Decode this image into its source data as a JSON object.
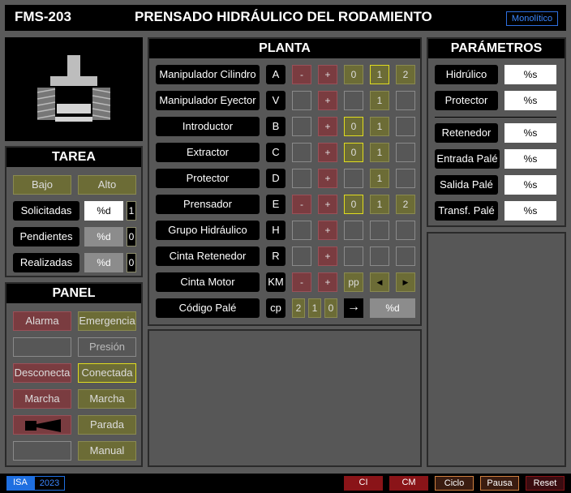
{
  "header": {
    "code": "FMS-203",
    "title": "PRENSADO HIDRÁULICO DEL RODAMIENTO",
    "mode": "Monolítico"
  },
  "tarea": {
    "title": "TAREA",
    "bajo": "Bajo",
    "alto": "Alto",
    "rows": [
      {
        "label": "Solicitadas",
        "value": "%d",
        "count": "1"
      },
      {
        "label": "Pendientes",
        "value": "%d",
        "count": "0"
      },
      {
        "label": "Realizadas",
        "value": "%d",
        "count": "0"
      }
    ]
  },
  "panel": {
    "title": "PANEL",
    "alarma": "Alarma",
    "emergencia": "Emergencia",
    "presion": "Presión",
    "desconecta": "Desconecta",
    "conectada": "Conectada",
    "marcha_left": "Marcha",
    "marcha_right": "Marcha",
    "parada": "Parada",
    "manual": "Manual"
  },
  "planta": {
    "title": "PLANTA",
    "rows": [
      {
        "label": "Manipulador Cilindro",
        "key": "A",
        "minus": "-",
        "plus": "+",
        "b0": "0",
        "b1": "1",
        "b2": "2"
      },
      {
        "label": "Manipulador Eyector",
        "key": "V",
        "plus": "+",
        "b1": "1"
      },
      {
        "label": "Introductor",
        "key": "B",
        "plus": "+",
        "b0": "0",
        "b1": "1"
      },
      {
        "label": "Extractor",
        "key": "C",
        "plus": "+",
        "b0": "0",
        "b1": "1"
      },
      {
        "label": "Protector",
        "key": "D",
        "plus": "+",
        "b1": "1"
      },
      {
        "label": "Prensador",
        "key": "E",
        "minus": "-",
        "plus": "+",
        "b0": "0",
        "b1": "1",
        "b2": "2"
      },
      {
        "label": "Grupo Hidráulico",
        "key": "H",
        "plus": "+"
      },
      {
        "label": "Cinta Retenedor",
        "key": "R",
        "plus": "+"
      },
      {
        "label": "Cinta Motor",
        "key": "KM",
        "minus": "-",
        "plus": "+",
        "pp": "pp"
      },
      {
        "label": "Código Palé",
        "key": "cp",
        "d2": "2",
        "d1": "1",
        "d0": "0",
        "arrow": "→",
        "val": "%d"
      }
    ]
  },
  "parametros": {
    "title": "PARÁMETROS",
    "rows": [
      {
        "label": "Hidrúlico",
        "value": "%s"
      },
      {
        "label": "Protector",
        "value": "%s"
      },
      {
        "label": "Retenedor",
        "value": "%s"
      },
      {
        "label": "Entrada Palé",
        "value": "%s"
      },
      {
        "label": "Salida Palé",
        "value": "%s"
      },
      {
        "label": "Transf. Palé",
        "value": "%s"
      }
    ]
  },
  "footer": {
    "isa": "ISA",
    "year": "2023",
    "ci": "CI",
    "cm": "CM",
    "ciclo": "Ciclo",
    "pausa": "Pausa",
    "reset": "Reset"
  },
  "colors": {
    "red": "#7a3c40",
    "olive": "#6c6c36",
    "accent": "#e0dc20",
    "blue": "#1e6fe0"
  }
}
